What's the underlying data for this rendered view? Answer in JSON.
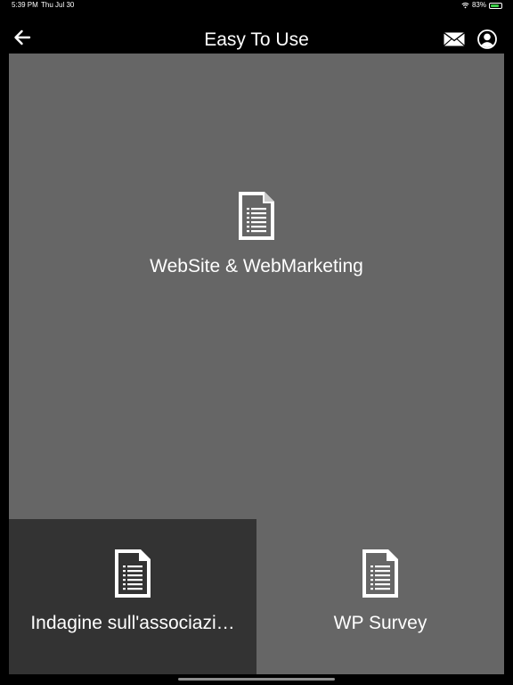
{
  "status_bar": {
    "time": "5:39 PM",
    "date": "Thu Jul 30",
    "battery_text": "83%",
    "battery_level": 0.83,
    "battery_color": "#3ecf4a"
  },
  "nav": {
    "title": "Easy To Use",
    "back_icon": "back-arrow-icon",
    "mail_icon": "mail-icon",
    "profile_icon": "profile-icon"
  },
  "tiles": [
    {
      "label": "WebSite & WebMarketing",
      "icon": "document-icon",
      "color": "#666666"
    },
    {
      "label": "Indagine sull'associazi…",
      "icon": "document-icon",
      "color": "#333333"
    },
    {
      "label": "WP Survey",
      "icon": "document-icon",
      "color": "#666666"
    }
  ]
}
